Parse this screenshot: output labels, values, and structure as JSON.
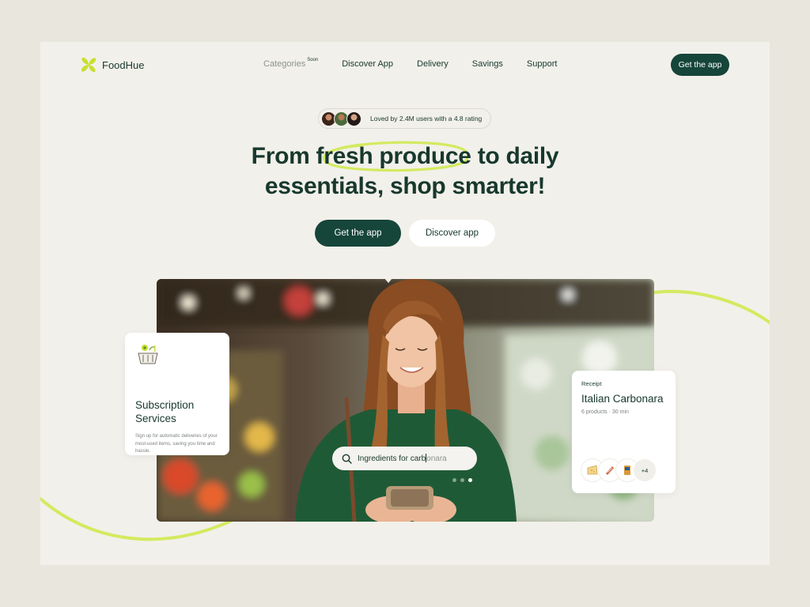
{
  "brand": {
    "name": "FoodHue",
    "accent": "#cfe65a",
    "primary": "#16453a",
    "logo_icon": "clover-logo-icon"
  },
  "nav": {
    "items": [
      {
        "label": "Categories",
        "badge": "Soon",
        "muted": true
      },
      {
        "label": "Discover App"
      },
      {
        "label": "Delivery"
      },
      {
        "label": "Savings"
      },
      {
        "label": "Support"
      }
    ],
    "cta": "Get the app"
  },
  "rating": {
    "text": "Loved by 2.4M users with a 4.8 rating"
  },
  "hero": {
    "headline_line1_pre": "From ",
    "headline_highlight": "fresh produce",
    "headline_line1_post": " to daily",
    "headline_line2": "essentials, shop smarter!",
    "primary_button": "Get the app",
    "secondary_button": "Discover app"
  },
  "search": {
    "typed": "Ingredients for carb",
    "suggestion": "onara",
    "icon": "search-icon"
  },
  "carousel": {
    "count": 3,
    "active_index": 2
  },
  "subscription_card": {
    "title": "Subscription Services",
    "description": "Sign up for automatic deliveries of your most-used items, saving you time and hassle.",
    "icon": "basket-icon"
  },
  "receipt_card": {
    "label": "Receipt",
    "title": "Italian Carbonara",
    "meta": "6 products · 30 min",
    "products": [
      "cheese-icon",
      "bacon-icon",
      "pasta-icon"
    ],
    "more": "+4"
  }
}
